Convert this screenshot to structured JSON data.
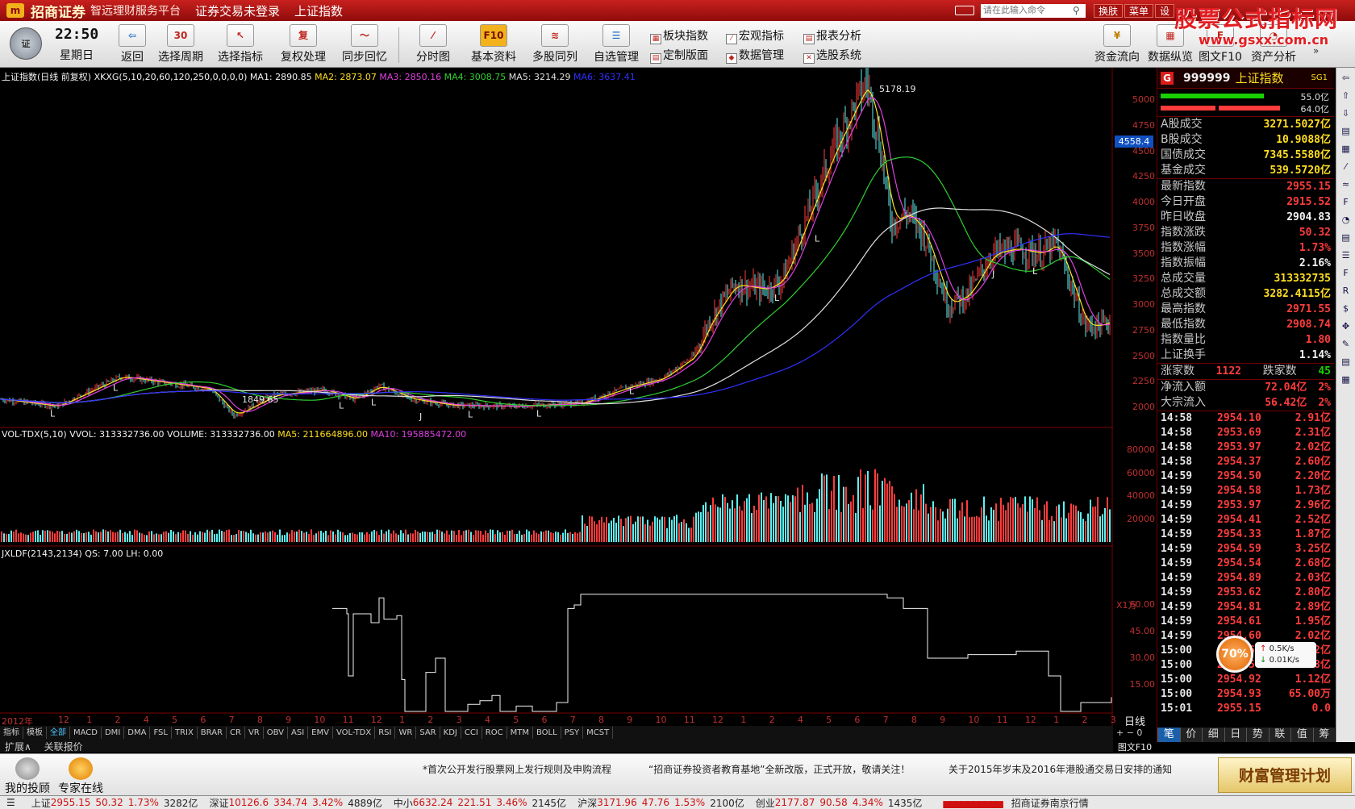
{
  "titlebar": {
    "brand": "招商证券",
    "subtitle": "智远理财服务平台",
    "login": "证券交易未登录",
    "current": "上证指数",
    "cmd_placeholder": "请在此输入命令",
    "buttons": [
      "换肤",
      "菜单",
      "设"
    ]
  },
  "watermark": {
    "line1": "股票公式指标网",
    "line2": "www.gsxx.com.cn"
  },
  "toolbar": {
    "time": "22:50",
    "weekday": "星期日",
    "buttons": [
      {
        "label": "返回",
        "icon": "back-icon"
      },
      {
        "label": "选择周期",
        "icon": "period-icon"
      },
      {
        "label": "选择指标",
        "icon": "indicator-icon"
      },
      {
        "label": "复权处理",
        "icon": "adjust-icon"
      },
      {
        "label": "同步回忆",
        "icon": "sync-icon"
      },
      {
        "label": "分时图",
        "icon": "minute-chart-icon"
      },
      {
        "label": "基本资料",
        "icon": "f10-icon"
      },
      {
        "label": "多股同列",
        "icon": "multi-stock-icon"
      },
      {
        "label": "自选管理",
        "icon": "watchlist-icon"
      }
    ],
    "small": [
      "板块指数",
      "定制版面",
      "宏观指标",
      "数据管理",
      "报表分析",
      "选股系统"
    ],
    "right": [
      "资金流向",
      "数据纵览",
      "图文F10",
      "资产分析"
    ]
  },
  "main_chart": {
    "header": {
      "title": "上证指数(日线 前复权) XKXG(5,10,20,60,120,250,0,0,0,0)",
      "ma1": "MA1: 2890.85",
      "ma2": "MA2: 2873.07",
      "ma3": "MA3: 2850.16",
      "ma4": "MA4: 3008.75",
      "ma5": "MA5: 3214.29",
      "ma6": "MA6: 3637.41"
    },
    "high_label": "5178.19",
    "low_label": "1849.65",
    "price_flag": "4558.4",
    "yticks": [
      "5000",
      "4750",
      "4500",
      "4250",
      "4000",
      "3750",
      "3500",
      "3250",
      "3000",
      "2750",
      "2500",
      "2250",
      "2000"
    ],
    "markers": [
      "L",
      "L",
      "L",
      "L",
      "J",
      "L",
      "L",
      "L",
      "L",
      "L",
      "J",
      "L"
    ]
  },
  "volume_chart": {
    "header": {
      "title": "VOL-TDX(5,10)",
      "vvol": "VVOL: 313332736.00",
      "volume": "VOLUME: 313332736.00",
      "ma5": "MA5: 211664896.00",
      "ma10": "MA10: 195885472.00"
    },
    "yticks": [
      "80000",
      "60000",
      "40000",
      "20000"
    ],
    "unit": "X1万"
  },
  "ind_chart": {
    "header": {
      "title": "JXLDF(2143,2134)",
      "qs": "QS: 7.00",
      "lh": "LH: 0.00"
    },
    "yticks": [
      "60.00",
      "45.00",
      "30.00",
      "15.00"
    ]
  },
  "xaxis": {
    "year": "2012年",
    "months": [
      "12",
      "1",
      "2",
      "4",
      "5",
      "6",
      "7",
      "8",
      "9",
      "10",
      "11",
      "12",
      "1",
      "2",
      "3",
      "4",
      "5",
      "6",
      "7",
      "8",
      "9",
      "10",
      "11",
      "12",
      "1",
      "2",
      "4",
      "5",
      "6",
      "7",
      "8",
      "9",
      "10",
      "11",
      "12",
      "1",
      "2",
      "3"
    ]
  },
  "index_tabs": [
    "指标",
    "模板",
    "全部",
    "MACD",
    "DMI",
    "DMA",
    "FSL",
    "TRIX",
    "BRAR",
    "CR",
    "VR",
    "OBV",
    "ASI",
    "EMV",
    "VOL-TDX",
    "RSI",
    "WR",
    "SAR",
    "KDJ",
    "CCI",
    "ROC",
    "MTM",
    "BOLL",
    "PSY",
    "MCST"
  ],
  "ext_tabs": [
    "扩展∧",
    "关联报价"
  ],
  "period_label": "日线",
  "f10_tab": "图文F10",
  "quote": {
    "code": "999999",
    "name": "上证指数",
    "tag": "SG1",
    "bar_a": "55.0亿",
    "bar_b": "64.0亿",
    "volume_rows": [
      {
        "k": "A股成交",
        "v": "3271.5027亿"
      },
      {
        "k": "B股成交",
        "v": "10.9088亿"
      },
      {
        "k": "国债成交",
        "v": "7345.5580亿"
      },
      {
        "k": "基金成交",
        "v": "539.5720亿"
      }
    ],
    "price_rows": [
      {
        "k": "最新指数",
        "v": "2955.15",
        "c": "red"
      },
      {
        "k": "今日开盘",
        "v": "2915.52",
        "c": "red"
      },
      {
        "k": "昨日收盘",
        "v": "2904.83",
        "c": "white"
      },
      {
        "k": "指数涨跌",
        "v": "50.32",
        "c": "red"
      },
      {
        "k": "指数涨幅",
        "v": "1.73%",
        "c": "red"
      },
      {
        "k": "指数振幅",
        "v": "2.16%",
        "c": "white"
      },
      {
        "k": "总成交量",
        "v": "313332735",
        "c": "yellow"
      },
      {
        "k": "总成交额",
        "v": "3282.4115亿",
        "c": "yellow"
      },
      {
        "k": "最高指数",
        "v": "2971.55",
        "c": "red"
      },
      {
        "k": "最低指数",
        "v": "2908.74",
        "c": "red"
      },
      {
        "k": "指数量比",
        "v": "1.80",
        "c": "red"
      },
      {
        "k": "上证换手",
        "v": "1.14%",
        "c": "white"
      }
    ],
    "rise_label": "涨家数",
    "rise_count": "1122",
    "fall_label": "跌家数",
    "fall_count": "45",
    "flow_rows": [
      {
        "k": "净流入额",
        "v": "72.04亿",
        "p": "2%"
      },
      {
        "k": "大宗流入",
        "v": "56.42亿",
        "p": "2%"
      }
    ],
    "ticks": [
      {
        "t": "14:58",
        "p": "2954.10",
        "q": "2.91亿"
      },
      {
        "t": "14:58",
        "p": "2953.69",
        "q": "2.31亿"
      },
      {
        "t": "14:58",
        "p": "2953.97",
        "q": "2.02亿"
      },
      {
        "t": "14:58",
        "p": "2954.37",
        "q": "2.60亿"
      },
      {
        "t": "14:59",
        "p": "2954.50",
        "q": "2.20亿"
      },
      {
        "t": "14:59",
        "p": "2954.58",
        "q": "1.73亿"
      },
      {
        "t": "14:59",
        "p": "2953.97",
        "q": "2.96亿"
      },
      {
        "t": "14:59",
        "p": "2954.41",
        "q": "2.52亿"
      },
      {
        "t": "14:59",
        "p": "2954.33",
        "q": "1.87亿"
      },
      {
        "t": "14:59",
        "p": "2954.59",
        "q": "3.25亿"
      },
      {
        "t": "14:59",
        "p": "2954.54",
        "q": "2.68亿"
      },
      {
        "t": "14:59",
        "p": "2954.89",
        "q": "2.03亿"
      },
      {
        "t": "14:59",
        "p": "2953.62",
        "q": "2.80亿"
      },
      {
        "t": "14:59",
        "p": "2954.81",
        "q": "2.89亿"
      },
      {
        "t": "14:59",
        "p": "2954.61",
        "q": "1.95亿"
      },
      {
        "t": "14:59",
        "p": "2954.60",
        "q": "2.02亿"
      },
      {
        "t": "15:00",
        "p": "2954.60",
        "q": "2.72亿"
      },
      {
        "t": "15:00",
        "p": "2954.54",
        "q": "1.68亿"
      },
      {
        "t": "15:00",
        "p": "2954.92",
        "q": "1.12亿"
      },
      {
        "t": "15:00",
        "p": "2954.93",
        "q": "65.00万"
      },
      {
        "t": "15:01",
        "p": "2955.15",
        "q": "0.0"
      }
    ],
    "tabs": [
      "笔",
      "价",
      "细",
      "日",
      "势",
      "联",
      "值",
      "筹"
    ]
  },
  "float_widget": {
    "pct": "70%",
    "up": "0.5K/s",
    "down": "0.01K/s"
  },
  "news": {
    "advisor": "我的投顾",
    "expert": "专家在线",
    "items": [
      "*首次公开发行股票网上发行规则及申购流程",
      "“招商证券投资者教育基地”全新改版，正式开放，敬请关注！",
      "关于2015年岁末及2016年港股通交易日安排的通知"
    ],
    "wealth": "财富管理计划"
  },
  "status": {
    "items": [
      {
        "name": "上证",
        "price": "2955.15",
        "chg": "50.32",
        "pct": "1.73%",
        "amt": "3282亿"
      },
      {
        "name": "深证",
        "price": "10126.6",
        "chg": "334.74",
        "pct": "3.42%",
        "amt": "4889亿"
      },
      {
        "name": "中小",
        "price": "6632.24",
        "chg": "221.51",
        "pct": "3.46%",
        "amt": "2145亿"
      },
      {
        "name": "沪深",
        "price": "3171.96",
        "chg": "47.76",
        "pct": "1.53%",
        "amt": "2100亿"
      },
      {
        "name": "创业",
        "price": "2177.87",
        "chg": "90.58",
        "pct": "4.34%",
        "amt": "1435亿"
      }
    ],
    "server": "招商证券南京行情"
  }
}
